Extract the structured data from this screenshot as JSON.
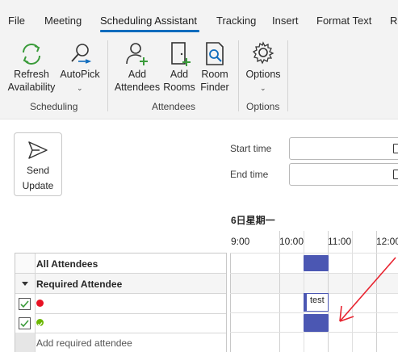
{
  "tabs": [
    {
      "label": "File"
    },
    {
      "label": "Meeting"
    },
    {
      "label": "Scheduling Assistant"
    },
    {
      "label": "Tracking"
    },
    {
      "label": "Insert"
    },
    {
      "label": "Format Text"
    },
    {
      "label": "Re"
    }
  ],
  "active_tab": "Scheduling Assistant",
  "ribbon": {
    "scheduling": {
      "refresh_line1": "Refresh",
      "refresh_line2": "Availability",
      "autopick": "AutoPick",
      "group_label": "Scheduling"
    },
    "attendees": {
      "add_attendees_line1": "Add",
      "add_attendees_line2": "Attendees",
      "add_rooms_line1": "Add",
      "add_rooms_line2": "Rooms",
      "room_finder_line1": "Room",
      "room_finder_line2": "Finder",
      "group_label": "Attendees"
    },
    "options": {
      "options_label": "Options",
      "group_label": "Options"
    }
  },
  "send_update": {
    "line1": "Send",
    "line2": "Update"
  },
  "fields": {
    "start_time_label": "Start time",
    "end_time_label": "End time",
    "start_time_value": "",
    "end_time_value": ""
  },
  "schedule": {
    "date_header": "6日星期一",
    "times": [
      "9:00",
      "10:00",
      "11:00",
      "12:00"
    ]
  },
  "attendees_table": {
    "header": "All Attendees",
    "required_section": "Required Attendee",
    "add_placeholder": "Add required attendee",
    "rows": [
      {
        "checked": true,
        "status_color": "#e81123"
      },
      {
        "checked": true,
        "status_color": "#6bb700"
      }
    ]
  },
  "meeting_block_label": "test",
  "colors": {
    "accent": "#0f6cbd",
    "busy": "#4b57b3",
    "annotation": "#e8232f"
  }
}
